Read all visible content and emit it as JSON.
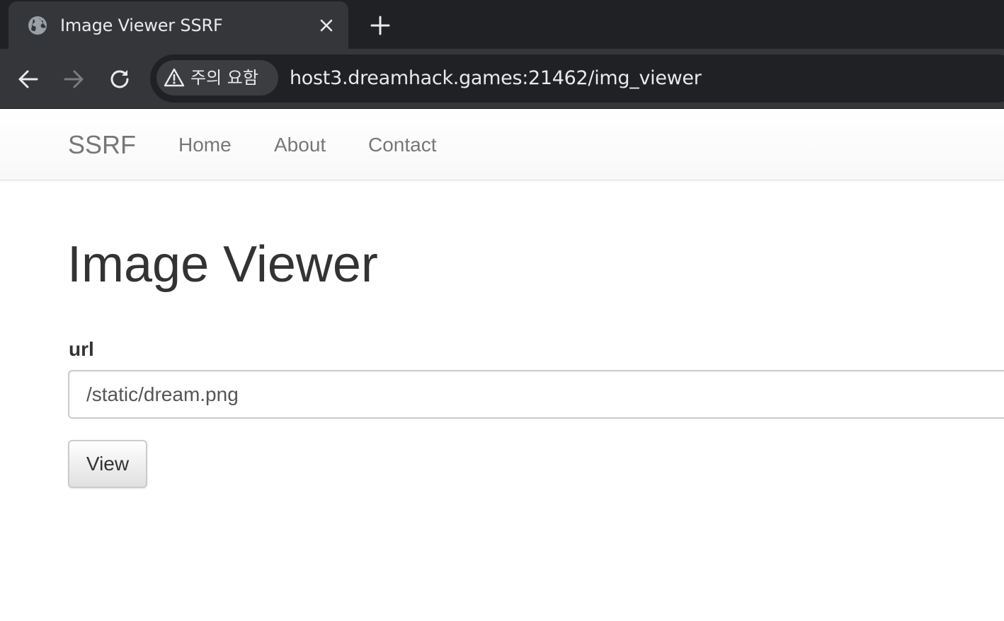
{
  "browser": {
    "tab": {
      "title": "Image Viewer SSRF",
      "favicon": "globe-icon"
    },
    "security_chip": {
      "icon": "warning-icon",
      "label": "주의 요함"
    },
    "address_bar": {
      "url": "host3.dreamhack.games:21462/img_viewer"
    },
    "colors": {
      "tabstrip": "#202124",
      "toolbar": "#35363a",
      "text": "#e8eaed"
    }
  },
  "navbar": {
    "brand": "SSRF",
    "links": [
      "Home",
      "About",
      "Contact"
    ]
  },
  "main": {
    "heading": "Image Viewer",
    "form": {
      "label": "url",
      "input_value": "/static/dream.png",
      "submit_label": "View"
    }
  }
}
